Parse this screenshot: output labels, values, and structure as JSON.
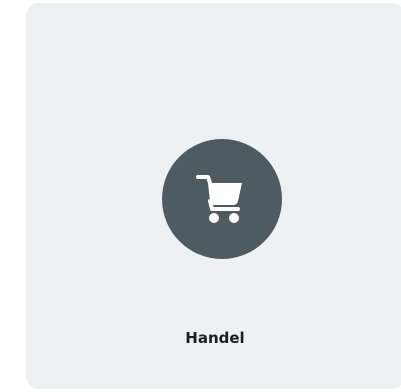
{
  "card": {
    "label": "Handel",
    "icon": "shopping-cart-icon",
    "background_color": "#eef1f3",
    "icon_circle_color": "#4e5b63",
    "icon_color": "#ffffff",
    "label_color": "#1e1e1e"
  }
}
